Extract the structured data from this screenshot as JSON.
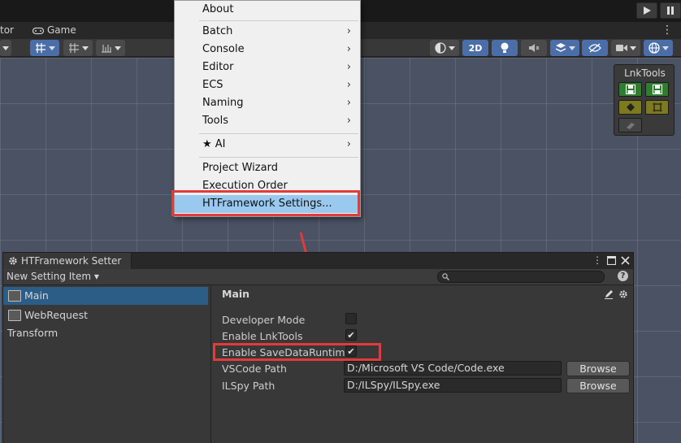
{
  "tabs": {
    "tab1_label": "tor",
    "tab2_label": "Game",
    "toggle_2d_label": "2D"
  },
  "lnktools": {
    "title": "LnkTools"
  },
  "menu": {
    "items": [
      {
        "label": "About",
        "arrow": ""
      },
      {
        "label": "Batch",
        "arrow": "›"
      },
      {
        "label": "Console",
        "arrow": "›"
      },
      {
        "label": "Editor",
        "arrow": "›"
      },
      {
        "label": "ECS",
        "arrow": "›"
      },
      {
        "label": "Naming",
        "arrow": "›"
      },
      {
        "label": "Tools",
        "arrow": "›"
      },
      {
        "label": "★ AI",
        "arrow": "›"
      },
      {
        "label": "Project Wizard",
        "arrow": ""
      },
      {
        "label": "Execution Order",
        "arrow": ""
      },
      {
        "label": "HTFramework Settings...",
        "arrow": ""
      }
    ]
  },
  "window": {
    "title": "HTFramework Setter",
    "new_setting_label": "New Setting Item ▾",
    "search_placeholder": "",
    "help_label": "?",
    "left_items": [
      {
        "label": "Main",
        "selected": true,
        "has_icon": true
      },
      {
        "label": "WebRequest",
        "selected": false,
        "has_icon": true
      },
      {
        "label": "Transform",
        "selected": false,
        "has_icon": false
      }
    ],
    "panel": {
      "title": "Main",
      "developer_mode": {
        "label": "Developer Mode",
        "checked": false
      },
      "enable_lnktools": {
        "label": "Enable LnkTools",
        "checked": true
      },
      "enable_savedata": {
        "label": "Enable SaveDataRuntime",
        "checked": true
      },
      "vscode": {
        "label": "VSCode Path",
        "value": "D:/Microsoft VS Code/Code.exe",
        "button": "Browse"
      },
      "ilspy": {
        "label": "ILSpy Path",
        "value": "D:/ILSpy/ILSpy.exe",
        "button": "Browse"
      }
    }
  },
  "colors": {
    "highlight_red": "#e23b3b",
    "selected_blue": "#2c5d87",
    "menu_selected": "#99c9ef",
    "lnk_green": "#2f7d2f",
    "lnk_olive": "#7d7a1f"
  }
}
